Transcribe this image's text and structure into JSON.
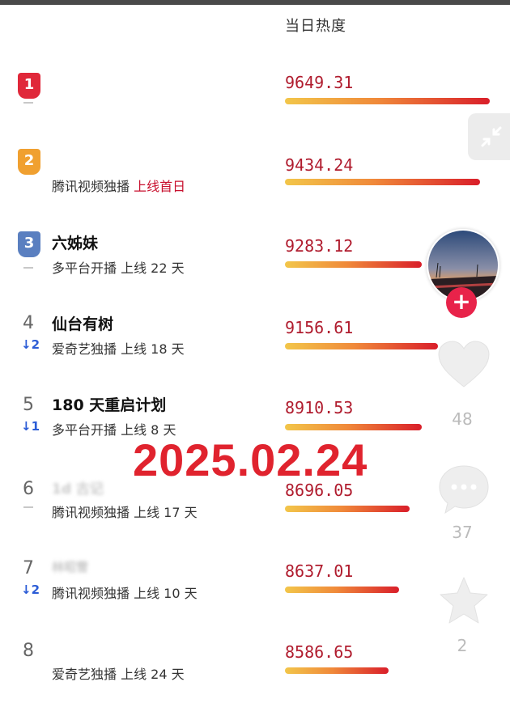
{
  "header": {
    "column_title": "当日热度"
  },
  "rows": [
    {
      "rank": "1",
      "badge_color": "#e0283a",
      "change": "",
      "title": "",
      "sub": "",
      "sub_highlight": "",
      "score": "9649.31",
      "bar_fraction": 0.99
    },
    {
      "rank": "2",
      "badge_color": "#f0a030",
      "change": "",
      "title": "",
      "sub": "腾讯视频独播 ",
      "sub_highlight": "上线首日",
      "score": "9434.24",
      "bar_fraction": 0.94
    },
    {
      "rank": "3",
      "badge_color": "#5a7fc0",
      "change": "",
      "title": "六姊妹",
      "sub": "多平台开播 上线 22 天",
      "sub_highlight": "",
      "score": "9283.12",
      "bar_fraction": 0.66
    },
    {
      "rank": "4",
      "badge_color": "",
      "change": "↓2",
      "title": "仙台有树",
      "sub": "爱奇艺独播 上线 18 天",
      "sub_highlight": "",
      "score": "9156.61",
      "bar_fraction": 0.74
    },
    {
      "rank": "5",
      "badge_color": "",
      "change": "↓1",
      "title": "180 天重启计划",
      "sub": "多平台开播 上线 8 天",
      "sub_highlight": "",
      "score": "8910.53",
      "bar_fraction": 0.66
    },
    {
      "rank": "6",
      "badge_color": "",
      "change": "",
      "title": "1d 古记",
      "sub": "腾讯视频独播 上线 17 天",
      "sub_highlight": "",
      "score": "8696.05",
      "bar_fraction": 0.6
    },
    {
      "rank": "7",
      "badge_color": "",
      "change": "↓2",
      "title": "林昭雪",
      "sub": "腾讯视频独播 上线 10 天",
      "sub_highlight": "",
      "score": "8637.01",
      "bar_fraction": 0.55
    },
    {
      "rank": "8",
      "badge_color": "",
      "change": "",
      "title": "",
      "sub": "爱奇艺独播 上线 24 天",
      "sub_highlight": "",
      "score": "8586.65",
      "bar_fraction": 0.5
    }
  ],
  "overlay": {
    "date_text": "2025.02.24"
  },
  "side": {
    "likes": "48",
    "comments": "37",
    "favorites": "2",
    "plus_label": "+",
    "icons": [
      "collapse-icon",
      "heart-icon",
      "comment-icon",
      "star-icon"
    ]
  }
}
